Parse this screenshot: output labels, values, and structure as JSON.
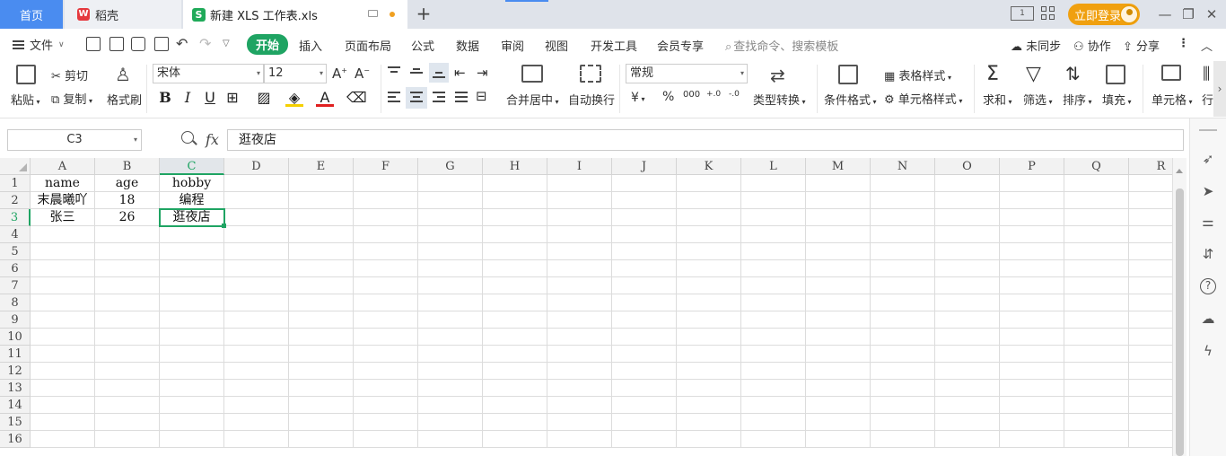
{
  "titlebar": {
    "home_tab": "首页",
    "daoke_tab": "稻壳",
    "daoke_logo_text": "W",
    "doc_logo_text": "S",
    "doc_tab": "新建 XLS 工作表.xls",
    "icon_book_text": "1",
    "login_button": "立即登录",
    "colors": {
      "home_tab_bg": "#4a8cf0",
      "login_bg": "#f0a010",
      "doc_logo": "#1faa59"
    }
  },
  "menubar": {
    "file": "文件",
    "tabs": [
      "开始",
      "插入",
      "页面布局",
      "公式",
      "数据",
      "审阅",
      "视图",
      "开发工具",
      "会员专享"
    ],
    "active_tab": "开始",
    "search_placeholder": "查找命令、搜索模板",
    "right_items": [
      "未同步",
      "协作",
      "分享"
    ]
  },
  "ribbon": {
    "paste": "粘贴",
    "cut": "剪切",
    "copy": "复制",
    "format_painter": "格式刷",
    "font_name": "宋体",
    "font_size": "12",
    "merge_center": "合并居中",
    "wrap_text": "自动换行",
    "number_format": "常规",
    "type_convert": "类型转换",
    "conditional_format": "条件格式",
    "table_style": "表格样式",
    "cell_style": "单元格样式",
    "sum": "求和",
    "filter": "筛选",
    "sort": "排序",
    "fill": "填充",
    "cell": "单元格",
    "row_col_partial": "行",
    "currency_symbol": "¥",
    "percent_symbol": "%",
    "thousands_symbol": "000",
    "decimal_increase": "+.0",
    "decimal_decrease": "-.0"
  },
  "formula_bar": {
    "name_box": "C3",
    "fx_label": "fx",
    "formula": "逛夜店"
  },
  "sheet": {
    "columns": [
      "A",
      "B",
      "C",
      "D",
      "E",
      "F",
      "G",
      "H",
      "I",
      "J",
      "K",
      "L",
      "M",
      "N",
      "O",
      "P",
      "Q",
      "R"
    ],
    "selected_column": "C",
    "selected_row": 3,
    "active_cell": "C3",
    "rows": [
      [
        "name",
        "age",
        "hobby"
      ],
      [
        "末晨曦吖",
        "18",
        "编程"
      ],
      [
        "张三",
        "26",
        "逛夜店"
      ],
      [],
      [],
      [],
      [],
      [],
      [],
      [],
      [],
      [],
      [],
      [],
      [],
      []
    ],
    "accent_color": "#1fa463"
  }
}
